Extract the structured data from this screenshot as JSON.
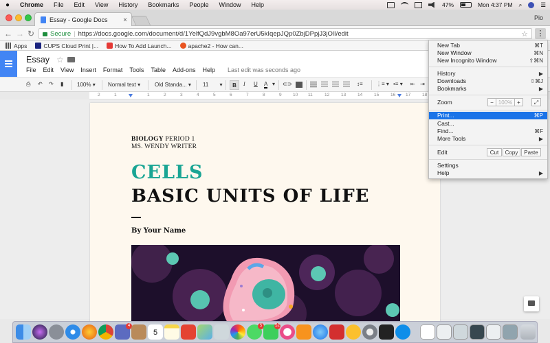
{
  "menubar": {
    "apple": "",
    "items": [
      "Chrome",
      "File",
      "Edit",
      "View",
      "History",
      "Bookmarks",
      "People",
      "Window",
      "Help"
    ],
    "battery_percent": "47%",
    "battery_level": 0.47,
    "clock": "Mon 4:37 PM"
  },
  "browser": {
    "tab_title": "Essay - Google Docs",
    "profile": "Pio",
    "secure_label": "Secure",
    "url": "https://docs.google.com/document/d/1YelfQdJ9vgbM8Oa97erU5kIqepJQp0ZbjDPpjJ3jOlI/edit"
  },
  "bookmarks": [
    {
      "label": "Apps",
      "icon": "apps-grid-icon",
      "color": "#555555"
    },
    {
      "label": "CUPS Cloud Print |...",
      "icon": "cups-icon",
      "color": "#1a237e"
    },
    {
      "label": "How To Add Launch...",
      "icon": "youtube-icon",
      "color": "#e53935"
    },
    {
      "label": "apache2 - How can...",
      "icon": "askubuntu-icon",
      "color": "#e95420"
    }
  ],
  "docs": {
    "title": "Essay",
    "menu": [
      "File",
      "Edit",
      "View",
      "Insert",
      "Format",
      "Tools",
      "Table",
      "Add-ons",
      "Help"
    ],
    "last_edit": "Last edit was seconds ago",
    "zoom": "100%",
    "style": "Normal text",
    "font": "Old Standa...",
    "size": "11",
    "ruler_ticks": [
      "2",
      "1",
      "1",
      "2",
      "3",
      "4",
      "5",
      "6",
      "7",
      "8",
      "9",
      "10",
      "11",
      "12",
      "13",
      "14",
      "15",
      "16",
      "17",
      "18"
    ]
  },
  "document": {
    "subject_bold": "BIOLOGY",
    "subject_rest": " PERIOD 1",
    "teacher": "MS. WENDY WRITER",
    "heading_accent": "CELLS",
    "heading_main": "BASIC UNITS OF LIFE",
    "byline": "By Your Name",
    "accent_color": "#1aa594"
  },
  "chrome_menu": {
    "items": [
      {
        "label": "New Tab",
        "shortcut": "⌘T"
      },
      {
        "label": "New Window",
        "shortcut": "⌘N"
      },
      {
        "label": "New Incognito Window",
        "shortcut": "⇧⌘N"
      },
      {
        "label": "History",
        "shortcut": "▶"
      },
      {
        "label": "Downloads",
        "shortcut": "⇧⌘J"
      },
      {
        "label": "Bookmarks",
        "shortcut": "▶"
      },
      {
        "label": "Zoom",
        "shortcut": ""
      },
      {
        "label": "Print...",
        "shortcut": "⌘P"
      },
      {
        "label": "Cast...",
        "shortcut": ""
      },
      {
        "label": "Find...",
        "shortcut": "⌘F"
      },
      {
        "label": "More Tools",
        "shortcut": "▶"
      },
      {
        "label": "Edit",
        "shortcut": ""
      },
      {
        "label": "Settings",
        "shortcut": ""
      },
      {
        "label": "Help",
        "shortcut": "▶"
      }
    ],
    "zoom_minus": "−",
    "zoom_value": "100%",
    "zoom_plus": "+",
    "edit_cut": "Cut",
    "edit_copy": "Copy",
    "edit_paste": "Paste",
    "highlight_color": "#1a73e8"
  },
  "dock_badges": {
    "app_a": "4",
    "calendar_day": "5",
    "app_b": "5",
    "app_c": "52"
  }
}
